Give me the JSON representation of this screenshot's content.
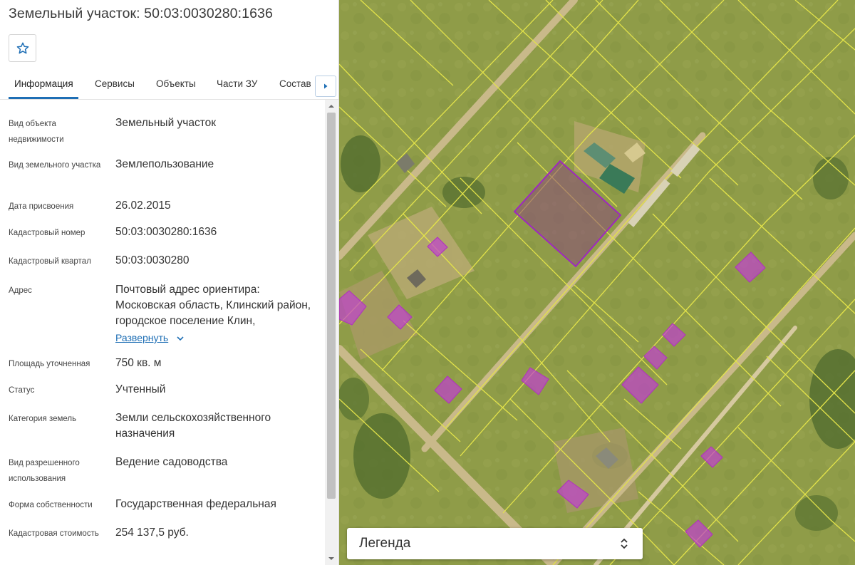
{
  "header": {
    "title": "Земельный участок: 50:03:0030280:1636"
  },
  "tabs": [
    {
      "label": "Информация",
      "active": true
    },
    {
      "label": "Сервисы",
      "active": false
    },
    {
      "label": "Объекты",
      "active": false
    },
    {
      "label": "Части ЗУ",
      "active": false
    },
    {
      "label": "Состав",
      "active": false
    }
  ],
  "info": [
    {
      "label": "Вид объекта недвижимости",
      "value": "Земельный участок"
    },
    {
      "label": "Вид земельного участка",
      "value": "Землепользование"
    },
    {
      "label": "Дата присвоения",
      "value": "26.02.2015"
    },
    {
      "label": "Кадастровый номер",
      "value": "50:03:0030280:1636"
    },
    {
      "label": "Кадастровый квартал",
      "value": "50:03:0030280"
    },
    {
      "label": "Адрес",
      "value": "Почтовый адрес ориентира: Московская область, Клинский район, городское поселение Клин,",
      "expand_label": "Развернуть"
    },
    {
      "label": "Площадь уточненная",
      "value": "750 кв. м"
    },
    {
      "label": "Статус",
      "value": "Учтенный"
    },
    {
      "label": "Категория земель",
      "value": "Земли сельскохозяйственного назначения"
    },
    {
      "label": "Вид разрешенного использования",
      "value": "Ведение садоводства"
    },
    {
      "label": "Форма собственности",
      "value": "Государственная федеральная"
    },
    {
      "label": "Кадастровая стоимость",
      "value": "254 137,5 руб."
    }
  ],
  "map": {
    "legend_label": "Легенда",
    "colors": {
      "grass": "#8d9b46",
      "parcel_border": "#e3e34a",
      "selected_parcel_border": "#a020c8",
      "building_fill": "#c040d0",
      "road": "#c9b98a"
    }
  },
  "icons": {
    "favorite": "star-outline-icon",
    "tabs_next": "caret-right-icon",
    "expand": "chevron-down-icon",
    "legend_toggle": "up-down-chevron-icon"
  }
}
